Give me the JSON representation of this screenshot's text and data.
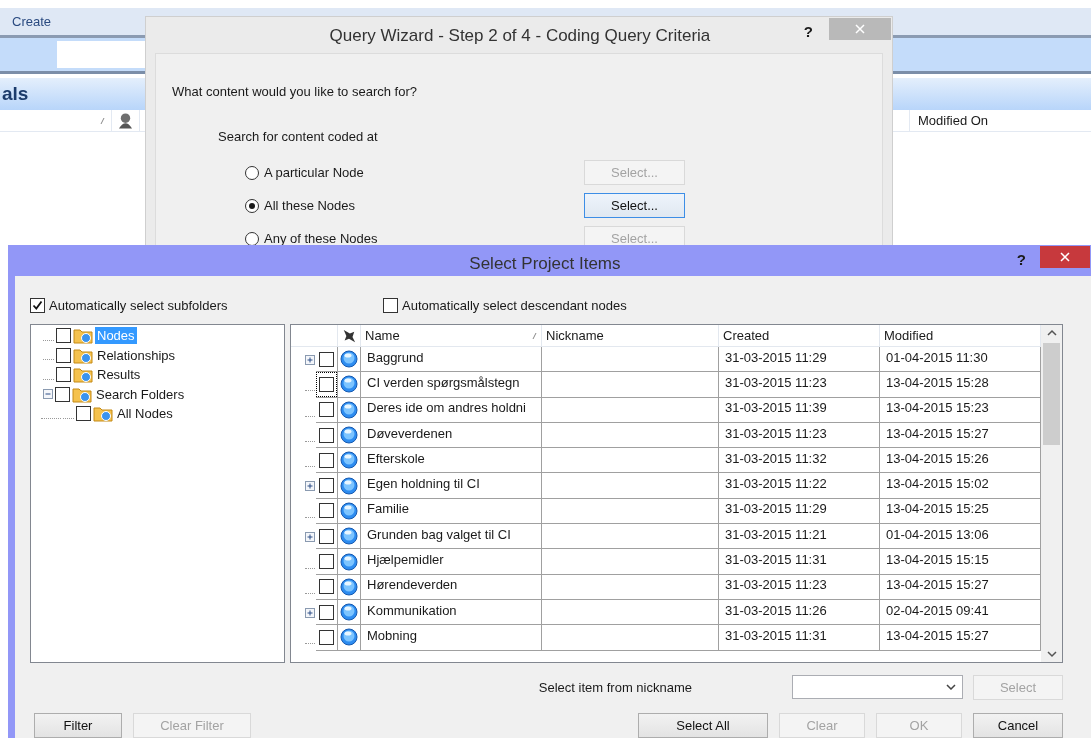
{
  "background_app": {
    "ribbon_tab": "Create",
    "view_title": "als",
    "column_header": "Modified On"
  },
  "query_wizard": {
    "title": "Query Wizard - Step 2 of 4 - Coding Query Criteria",
    "help": "?",
    "question": "What content would you like to search for?",
    "criteria_label": "Search for content coded at",
    "options": [
      {
        "label": "A particular Node",
        "selected": false,
        "button": {
          "label": "Select...",
          "disabled": true,
          "focused": false
        }
      },
      {
        "label": "All these Nodes",
        "selected": true,
        "button": {
          "label": "Select...",
          "disabled": false,
          "focused": true
        }
      },
      {
        "label": "Any of these Nodes",
        "selected": false,
        "button": {
          "label": "Select...",
          "disabled": true,
          "focused": false
        }
      }
    ]
  },
  "select_dialog": {
    "title": "Select Project Items",
    "help": "?",
    "options": [
      {
        "label": "Automatically select subfolders",
        "checked": true
      },
      {
        "label": "Automatically select descendant nodes",
        "checked": false
      }
    ],
    "tree": [
      {
        "label": "Nodes",
        "checked": false,
        "selected": true
      },
      {
        "label": "Relationships",
        "checked": false,
        "selected": false
      },
      {
        "label": "Results",
        "checked": false,
        "selected": false
      },
      {
        "label": "Search Folders",
        "checked": false,
        "selected": false,
        "expanded": true,
        "children": [
          {
            "label": "All Nodes",
            "checked": false,
            "selected": false
          }
        ]
      }
    ],
    "columns": [
      "Name",
      "Nickname",
      "Created",
      "Modified"
    ],
    "rows": [
      {
        "expandable": true,
        "checked": false,
        "focused": false,
        "name": "Baggrund",
        "created": "31-03-2015 11:29",
        "modified": "01-04-2015 11:30"
      },
      {
        "expandable": false,
        "checked": false,
        "focused": true,
        "name": "CI verden spørgsmålstegn",
        "created": "31-03-2015 11:23",
        "modified": "13-04-2015 15:28"
      },
      {
        "expandable": false,
        "checked": false,
        "focused": false,
        "name": "Deres ide om andres holdni",
        "created": "31-03-2015 11:39",
        "modified": "13-04-2015 15:23"
      },
      {
        "expandable": false,
        "checked": false,
        "focused": false,
        "name": "Døveverdenen",
        "created": "31-03-2015 11:23",
        "modified": "13-04-2015 15:27"
      },
      {
        "expandable": false,
        "checked": false,
        "focused": false,
        "name": "Efterskole",
        "created": "31-03-2015 11:32",
        "modified": "13-04-2015 15:26"
      },
      {
        "expandable": true,
        "checked": false,
        "focused": false,
        "name": "Egen holdning til CI",
        "created": "31-03-2015 11:22",
        "modified": "13-04-2015 15:02"
      },
      {
        "expandable": false,
        "checked": false,
        "focused": false,
        "name": "Familie",
        "created": "31-03-2015 11:29",
        "modified": "13-04-2015 15:25"
      },
      {
        "expandable": true,
        "checked": false,
        "focused": false,
        "name": "Grunden bag valget til CI",
        "created": "31-03-2015 11:21",
        "modified": "01-04-2015 13:06"
      },
      {
        "expandable": false,
        "checked": false,
        "focused": false,
        "name": "Hjælpemidler",
        "created": "31-03-2015 11:31",
        "modified": "13-04-2015 15:15"
      },
      {
        "expandable": false,
        "checked": false,
        "focused": false,
        "name": "Hørendeverden",
        "created": "31-03-2015 11:23",
        "modified": "13-04-2015 15:27"
      },
      {
        "expandable": true,
        "checked": false,
        "focused": false,
        "name": "Kommunikation",
        "created": "31-03-2015 11:26",
        "modified": "02-04-2015 09:41"
      },
      {
        "expandable": false,
        "checked": false,
        "focused": false,
        "name": "Mobning",
        "created": "31-03-2015 11:31",
        "modified": "13-04-2015 15:27"
      }
    ],
    "nickname_label": "Select item from nickname",
    "nickname_button": {
      "label": "Select",
      "disabled": true
    },
    "buttons": [
      {
        "label": "Filter",
        "disabled": false
      },
      {
        "label": "Clear Filter",
        "disabled": true
      },
      {
        "label": "Select All",
        "disabled": false
      },
      {
        "label": "Clear",
        "disabled": true
      },
      {
        "label": "OK",
        "disabled": true
      },
      {
        "label": "Cancel",
        "disabled": false
      }
    ]
  }
}
